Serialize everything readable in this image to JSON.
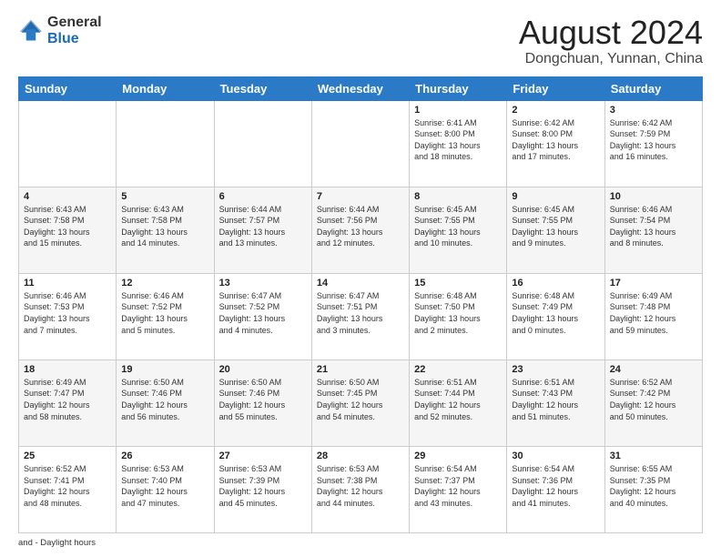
{
  "header": {
    "logo_general": "General",
    "logo_blue": "Blue",
    "month_year": "August 2024",
    "location": "Dongchuan, Yunnan, China"
  },
  "days_of_week": [
    "Sunday",
    "Monday",
    "Tuesday",
    "Wednesday",
    "Thursday",
    "Friday",
    "Saturday"
  ],
  "weeks": [
    [
      {
        "day": "",
        "info": ""
      },
      {
        "day": "",
        "info": ""
      },
      {
        "day": "",
        "info": ""
      },
      {
        "day": "",
        "info": ""
      },
      {
        "day": "1",
        "info": "Sunrise: 6:41 AM\nSunset: 8:00 PM\nDaylight: 13 hours\nand 18 minutes."
      },
      {
        "day": "2",
        "info": "Sunrise: 6:42 AM\nSunset: 8:00 PM\nDaylight: 13 hours\nand 17 minutes."
      },
      {
        "day": "3",
        "info": "Sunrise: 6:42 AM\nSunset: 7:59 PM\nDaylight: 13 hours\nand 16 minutes."
      }
    ],
    [
      {
        "day": "4",
        "info": "Sunrise: 6:43 AM\nSunset: 7:58 PM\nDaylight: 13 hours\nand 15 minutes."
      },
      {
        "day": "5",
        "info": "Sunrise: 6:43 AM\nSunset: 7:58 PM\nDaylight: 13 hours\nand 14 minutes."
      },
      {
        "day": "6",
        "info": "Sunrise: 6:44 AM\nSunset: 7:57 PM\nDaylight: 13 hours\nand 13 minutes."
      },
      {
        "day": "7",
        "info": "Sunrise: 6:44 AM\nSunset: 7:56 PM\nDaylight: 13 hours\nand 12 minutes."
      },
      {
        "day": "8",
        "info": "Sunrise: 6:45 AM\nSunset: 7:55 PM\nDaylight: 13 hours\nand 10 minutes."
      },
      {
        "day": "9",
        "info": "Sunrise: 6:45 AM\nSunset: 7:55 PM\nDaylight: 13 hours\nand 9 minutes."
      },
      {
        "day": "10",
        "info": "Sunrise: 6:46 AM\nSunset: 7:54 PM\nDaylight: 13 hours\nand 8 minutes."
      }
    ],
    [
      {
        "day": "11",
        "info": "Sunrise: 6:46 AM\nSunset: 7:53 PM\nDaylight: 13 hours\nand 7 minutes."
      },
      {
        "day": "12",
        "info": "Sunrise: 6:46 AM\nSunset: 7:52 PM\nDaylight: 13 hours\nand 5 minutes."
      },
      {
        "day": "13",
        "info": "Sunrise: 6:47 AM\nSunset: 7:52 PM\nDaylight: 13 hours\nand 4 minutes."
      },
      {
        "day": "14",
        "info": "Sunrise: 6:47 AM\nSunset: 7:51 PM\nDaylight: 13 hours\nand 3 minutes."
      },
      {
        "day": "15",
        "info": "Sunrise: 6:48 AM\nSunset: 7:50 PM\nDaylight: 13 hours\nand 2 minutes."
      },
      {
        "day": "16",
        "info": "Sunrise: 6:48 AM\nSunset: 7:49 PM\nDaylight: 13 hours\nand 0 minutes."
      },
      {
        "day": "17",
        "info": "Sunrise: 6:49 AM\nSunset: 7:48 PM\nDaylight: 12 hours\nand 59 minutes."
      }
    ],
    [
      {
        "day": "18",
        "info": "Sunrise: 6:49 AM\nSunset: 7:47 PM\nDaylight: 12 hours\nand 58 minutes."
      },
      {
        "day": "19",
        "info": "Sunrise: 6:50 AM\nSunset: 7:46 PM\nDaylight: 12 hours\nand 56 minutes."
      },
      {
        "day": "20",
        "info": "Sunrise: 6:50 AM\nSunset: 7:46 PM\nDaylight: 12 hours\nand 55 minutes."
      },
      {
        "day": "21",
        "info": "Sunrise: 6:50 AM\nSunset: 7:45 PM\nDaylight: 12 hours\nand 54 minutes."
      },
      {
        "day": "22",
        "info": "Sunrise: 6:51 AM\nSunset: 7:44 PM\nDaylight: 12 hours\nand 52 minutes."
      },
      {
        "day": "23",
        "info": "Sunrise: 6:51 AM\nSunset: 7:43 PM\nDaylight: 12 hours\nand 51 minutes."
      },
      {
        "day": "24",
        "info": "Sunrise: 6:52 AM\nSunset: 7:42 PM\nDaylight: 12 hours\nand 50 minutes."
      }
    ],
    [
      {
        "day": "25",
        "info": "Sunrise: 6:52 AM\nSunset: 7:41 PM\nDaylight: 12 hours\nand 48 minutes."
      },
      {
        "day": "26",
        "info": "Sunrise: 6:53 AM\nSunset: 7:40 PM\nDaylight: 12 hours\nand 47 minutes."
      },
      {
        "day": "27",
        "info": "Sunrise: 6:53 AM\nSunset: 7:39 PM\nDaylight: 12 hours\nand 45 minutes."
      },
      {
        "day": "28",
        "info": "Sunrise: 6:53 AM\nSunset: 7:38 PM\nDaylight: 12 hours\nand 44 minutes."
      },
      {
        "day": "29",
        "info": "Sunrise: 6:54 AM\nSunset: 7:37 PM\nDaylight: 12 hours\nand 43 minutes."
      },
      {
        "day": "30",
        "info": "Sunrise: 6:54 AM\nSunset: 7:36 PM\nDaylight: 12 hours\nand 41 minutes."
      },
      {
        "day": "31",
        "info": "Sunrise: 6:55 AM\nSunset: 7:35 PM\nDaylight: 12 hours\nand 40 minutes."
      }
    ]
  ],
  "footer": {
    "part1": "and -",
    "part2": "Daylight hours",
    "full": "and - Daylight hours"
  }
}
